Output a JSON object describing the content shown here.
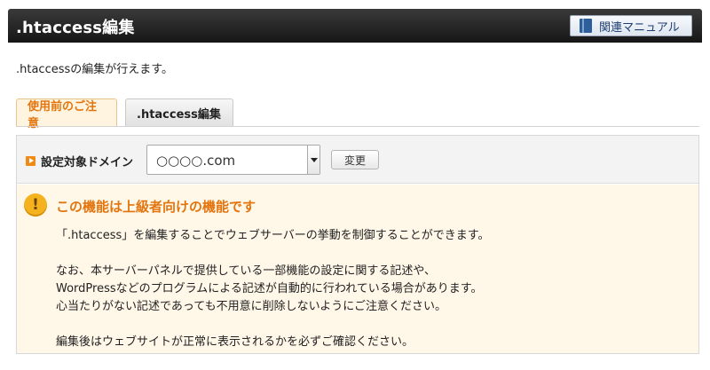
{
  "header": {
    "title": ".htaccess編集",
    "manual_button": "関連マニュアル",
    "manual_icon": "book-icon"
  },
  "description": ".htaccessの編集が行えます。",
  "tabs": [
    {
      "label": "使用前のご注意",
      "active": true
    },
    {
      "label": ".htaccess編集",
      "active": false
    }
  ],
  "domain": {
    "label": "設定対象ドメイン",
    "selected": "○○○○.com",
    "change_button": "変更"
  },
  "notice": {
    "title": "この機能は上級者向けの機能です",
    "icon_glyph": "!",
    "lines": [
      "「.htaccess」を編集することでウェブサーバーの挙動を制御することができます。",
      "なお、本サーバーパネルで提供している一部機能の設定に関する記述や、",
      "WordPressなどのプログラムによる記述が自動的に行われている場合があります。",
      "心当たりがない記述であっても不用意に削除しないようにご注意ください。",
      "編集後はウェブサイトが正常に表示されるかを必ずご確認ください。"
    ]
  },
  "colors": {
    "accent": "#e3750e",
    "notice_background": "#fff7e8",
    "header_background": "#1e1e1e",
    "warning_icon": "#f5b21f"
  }
}
